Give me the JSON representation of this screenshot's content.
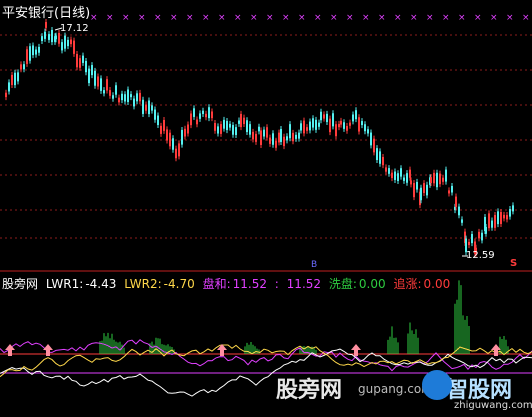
{
  "window": {
    "title": "平安银行(日线)"
  },
  "price_panel": {
    "high_label": "17.12",
    "low_label": "12.59",
    "marker_s": "S",
    "marker_b": "B"
  },
  "indicator": {
    "name": "股旁网",
    "lwr1_label": "LWR1:",
    "lwr1_value": "-4.43",
    "lwr2_label": "LWR2:",
    "lwr2_value": "-4.70",
    "panhe_label": "盘和:",
    "panhe_value": "11.52",
    "panhe_sep": ":",
    "panhe_value2": "11.52",
    "xipan_label": "洗盘:",
    "xipan_value": "0.00",
    "zhuizhang_label": "追涨:",
    "zhuizhang_value": "0.00"
  },
  "watermark": {
    "site_cn": "股旁网",
    "site_en": "gupang.com",
    "logo_cn": "智股网",
    "logo_en": "zhiguwang.com"
  },
  "colors": {
    "up": "#ff3b3b",
    "down": "#54f1f1",
    "grid": "#8b1b1b",
    "magenta": "#e040ff",
    "green": "#2ecc40",
    "yellow": "#ffd84a",
    "white": "#ffffff"
  }
}
